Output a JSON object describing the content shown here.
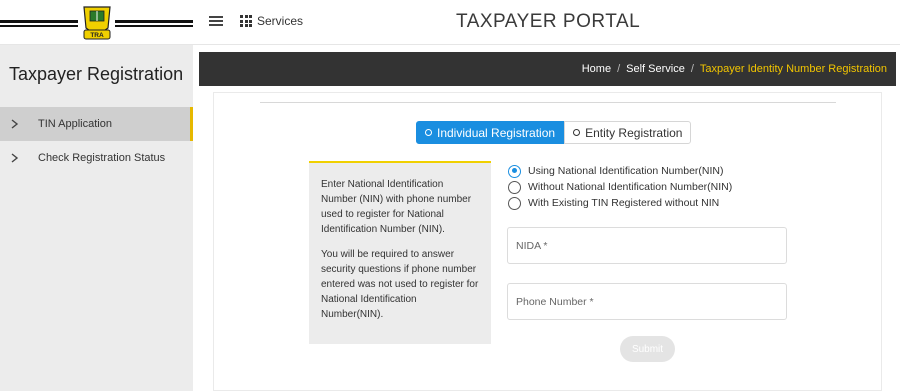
{
  "header": {
    "title": "TAXPAYER PORTAL",
    "services_label": "Services",
    "logo_text": "TRA",
    "icons": [
      "menu-icon",
      "grid-icon"
    ]
  },
  "sidebar": {
    "title": "Taxpayer Registration",
    "items": [
      {
        "label": "TIN Application",
        "active": true
      },
      {
        "label": "Check Registration Status",
        "active": false
      }
    ]
  },
  "breadcrumb": {
    "items": [
      "Home",
      "Self Service"
    ],
    "current": "Taxpayer Identity Number Registration"
  },
  "registration": {
    "types": [
      {
        "label": "Individual Registration",
        "selected": true
      },
      {
        "label": "Entity Registration",
        "selected": false
      }
    ],
    "info_paragraphs": [
      "Enter National Identification Number (NIN) with phone number used to register for National Identification Number (NIN).",
      "You will be required to answer security questions if phone number entered was not used to register for National Identification Number(NIN)."
    ],
    "options": [
      {
        "label": "Using National Identification Number(NIN)",
        "checked": true
      },
      {
        "label": "Without National Identification Number(NIN)",
        "checked": false
      },
      {
        "label": "With Existing TIN Registered without NIN",
        "checked": false
      }
    ],
    "nida_placeholder": "NIDA *",
    "phone_placeholder": "Phone Number *",
    "submit_label": "Submit"
  },
  "colors": {
    "accent": "#1a8ee0",
    "highlight": "#f2c500",
    "breadcrumb_bg": "#333333",
    "sidebar_bg": "#ececec"
  }
}
